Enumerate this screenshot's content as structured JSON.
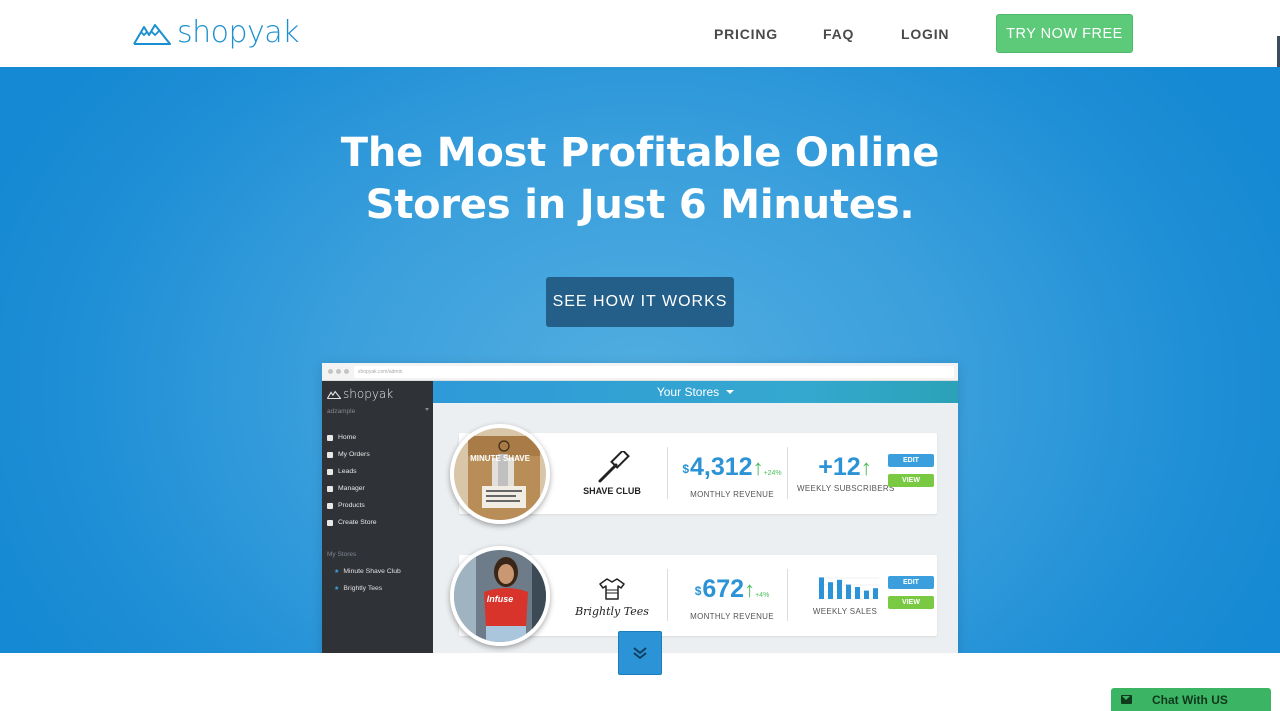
{
  "header": {
    "logo_text": "shopyak",
    "nav": {
      "pricing": "PRICING",
      "faq": "FAQ",
      "login": "LOGIN"
    },
    "cta": "TRY NOW FREE"
  },
  "hero": {
    "title_line1": "The Most Profitable Online",
    "title_line2": "Stores in Just 6 Minutes.",
    "button": "SEE HOW IT WORKS"
  },
  "mockup": {
    "url": "shopyak.com/admin",
    "sidebar": {
      "logo_text": "shopyak",
      "user": "adzample",
      "items": [
        {
          "label": "Home",
          "icon": "home-icon"
        },
        {
          "label": "My Orders",
          "icon": "bag-icon"
        },
        {
          "label": "Leads",
          "icon": "target-icon"
        },
        {
          "label": "Manager",
          "icon": "manager-icon"
        },
        {
          "label": "Products",
          "icon": "calendar-icon"
        },
        {
          "label": "Create Store",
          "icon": "plus-icon"
        }
      ],
      "stores_heading": "My Stores",
      "stores": [
        "Minute Shave Club",
        "Brightly Tees"
      ]
    },
    "content_title": "Your Stores",
    "stores": [
      {
        "photo_caption": "MINUTE SHAVE",
        "brand": "SHAVE CLUB",
        "revenue_currency": "$",
        "revenue": "4,312",
        "revenue_change": "+24%",
        "revenue_label": "MONTHLY REVENUE",
        "metric2_value": "+12",
        "metric2_label": "WEEKLY SUBSCRIBERS",
        "edit": "EDIT",
        "view": "VIEW"
      },
      {
        "photo_caption": "Infuse",
        "brand": "Brightly Tees",
        "revenue_currency": "$",
        "revenue": "672",
        "revenue_change": "+4%",
        "revenue_label": "MONTHLY REVENUE",
        "metric2_label": "WEEKLY SALES",
        "weekly_sales_bars": [
          0.9,
          0.7,
          0.8,
          0.6,
          0.5,
          0.35,
          0.45
        ],
        "edit": "EDIT",
        "view": "VIEW"
      }
    ]
  },
  "chat": {
    "label": "Chat With US"
  },
  "colors": {
    "brand_blue": "#1a8fd1",
    "cta_green": "#5dca7a",
    "hero_button": "#235f89",
    "chat_green": "#3bb563"
  }
}
